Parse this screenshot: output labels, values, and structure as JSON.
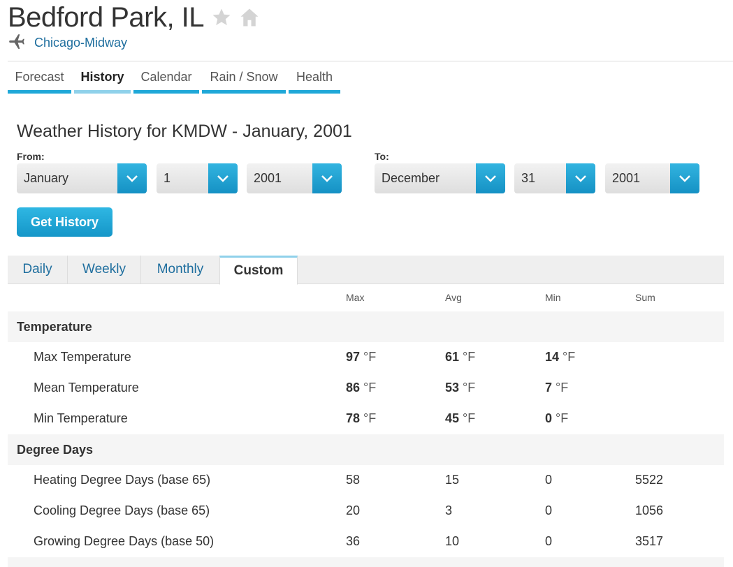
{
  "header": {
    "city": "Bedford Park, IL",
    "station": "Chicago-Midway"
  },
  "nav": [
    {
      "label": "Forecast"
    },
    {
      "label": "History"
    },
    {
      "label": "Calendar"
    },
    {
      "label": "Rain / Snow"
    },
    {
      "label": "Health"
    }
  ],
  "history": {
    "title": "Weather History for KMDW - January, 2001",
    "from_label": "From:",
    "to_label": "To:",
    "from_month": "January",
    "from_day": "1",
    "from_year": "2001",
    "to_month": "December",
    "to_day": "31",
    "to_year": "2001",
    "button": "Get History"
  },
  "view_tabs": [
    {
      "label": "Daily"
    },
    {
      "label": "Weekly"
    },
    {
      "label": "Monthly"
    },
    {
      "label": "Custom"
    }
  ],
  "table": {
    "columns": [
      "Max",
      "Avg",
      "Min",
      "Sum"
    ],
    "unit": "°F",
    "temperature_section": "Temperature",
    "temperature_rows": [
      {
        "label": "Max Temperature",
        "max": "97",
        "avg": "61",
        "min": "14"
      },
      {
        "label": "Mean Temperature",
        "max": "86",
        "avg": "53",
        "min": "7"
      },
      {
        "label": "Min Temperature",
        "max": "78",
        "avg": "45",
        "min": "0"
      }
    ],
    "degree_section": "Degree Days",
    "degree_rows": [
      {
        "label": "Heating Degree Days (base 65)",
        "max": "58",
        "avg": "15",
        "min": "0",
        "sum": "5522"
      },
      {
        "label": "Cooling Degree Days (base 65)",
        "max": "20",
        "avg": "3",
        "min": "0",
        "sum": "1056"
      },
      {
        "label": "Growing Degree Days (base 50)",
        "max": "36",
        "avg": "10",
        "min": "0",
        "sum": "3517"
      }
    ]
  },
  "colors": {
    "accent": "#1fa8d8",
    "link": "#1e6e9e",
    "active_tab": "#8fd1ea"
  }
}
